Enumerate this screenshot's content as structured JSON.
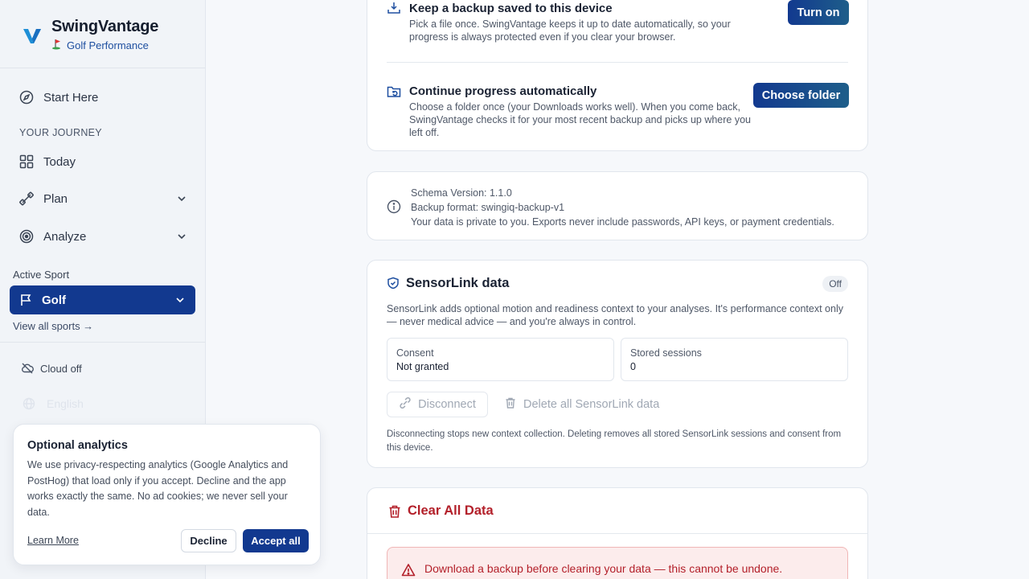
{
  "brand": {
    "name": "SwingVantage",
    "sub": "Golf Performance",
    "sub_icon": "golf-flag-icon",
    "accent": "#12398f"
  },
  "sidebar": {
    "start_here": "Start Here",
    "section_journey": "YOUR JOURNEY",
    "items": [
      {
        "label": "Today",
        "icon": "dashboard-icon"
      },
      {
        "label": "Plan",
        "icon": "dumbbell-icon"
      },
      {
        "label": "Analyze",
        "icon": "target-icon"
      }
    ],
    "active_sport_label": "Active Sport",
    "active_sport": "Golf",
    "view_all": "View all sports →",
    "cloud": "Cloud off",
    "language": "English"
  },
  "consent": {
    "title": "Optional analytics",
    "body": "We use privacy-respecting analytics (Google Analytics and PostHog) that load only if you accept. Decline and the app works exactly the same. No ad cookies; we never sell your data.",
    "learn_more": "Learn More",
    "decline": "Decline",
    "accept": "Accept all"
  },
  "backup": {
    "save_title": "Keep a backup saved to this device",
    "save_desc": "Pick a file once. SwingVantage keeps it up to date automatically, so your progress is always protected even if you clear your browser.",
    "save_button": "Turn on",
    "continue_title": "Continue progress automatically",
    "continue_desc": "Choose a folder once (your Downloads works well). When you come back, SwingVantage checks it for your most recent backup and picks up where you left off.",
    "continue_button": "Choose folder"
  },
  "info": {
    "schema": "Schema Version: 1.1.0",
    "format": "Backup format: swingiq-backup-v1",
    "privacy": "Your data is private to you. Exports never include passwords, API keys, or payment credentials."
  },
  "sensorlink": {
    "title": "SensorLink data",
    "status": "Off",
    "desc": "SensorLink adds optional motion and readiness context to your analyses. It's performance context only — never medical advice — and you're always in control.",
    "consent_label": "Consent",
    "consent_value": "Not granted",
    "sessions_label": "Stored sessions",
    "sessions_value": "0",
    "disconnect": "Disconnect",
    "delete_all": "Delete all SensorLink data",
    "footnote": "Disconnecting stops new context collection. Deleting removes all stored SensorLink sessions and consent from this device."
  },
  "clear": {
    "title": "Clear All Data",
    "warning": "Download a backup before clearing your data — this cannot be undone.",
    "danger_color": "#b3202a"
  }
}
